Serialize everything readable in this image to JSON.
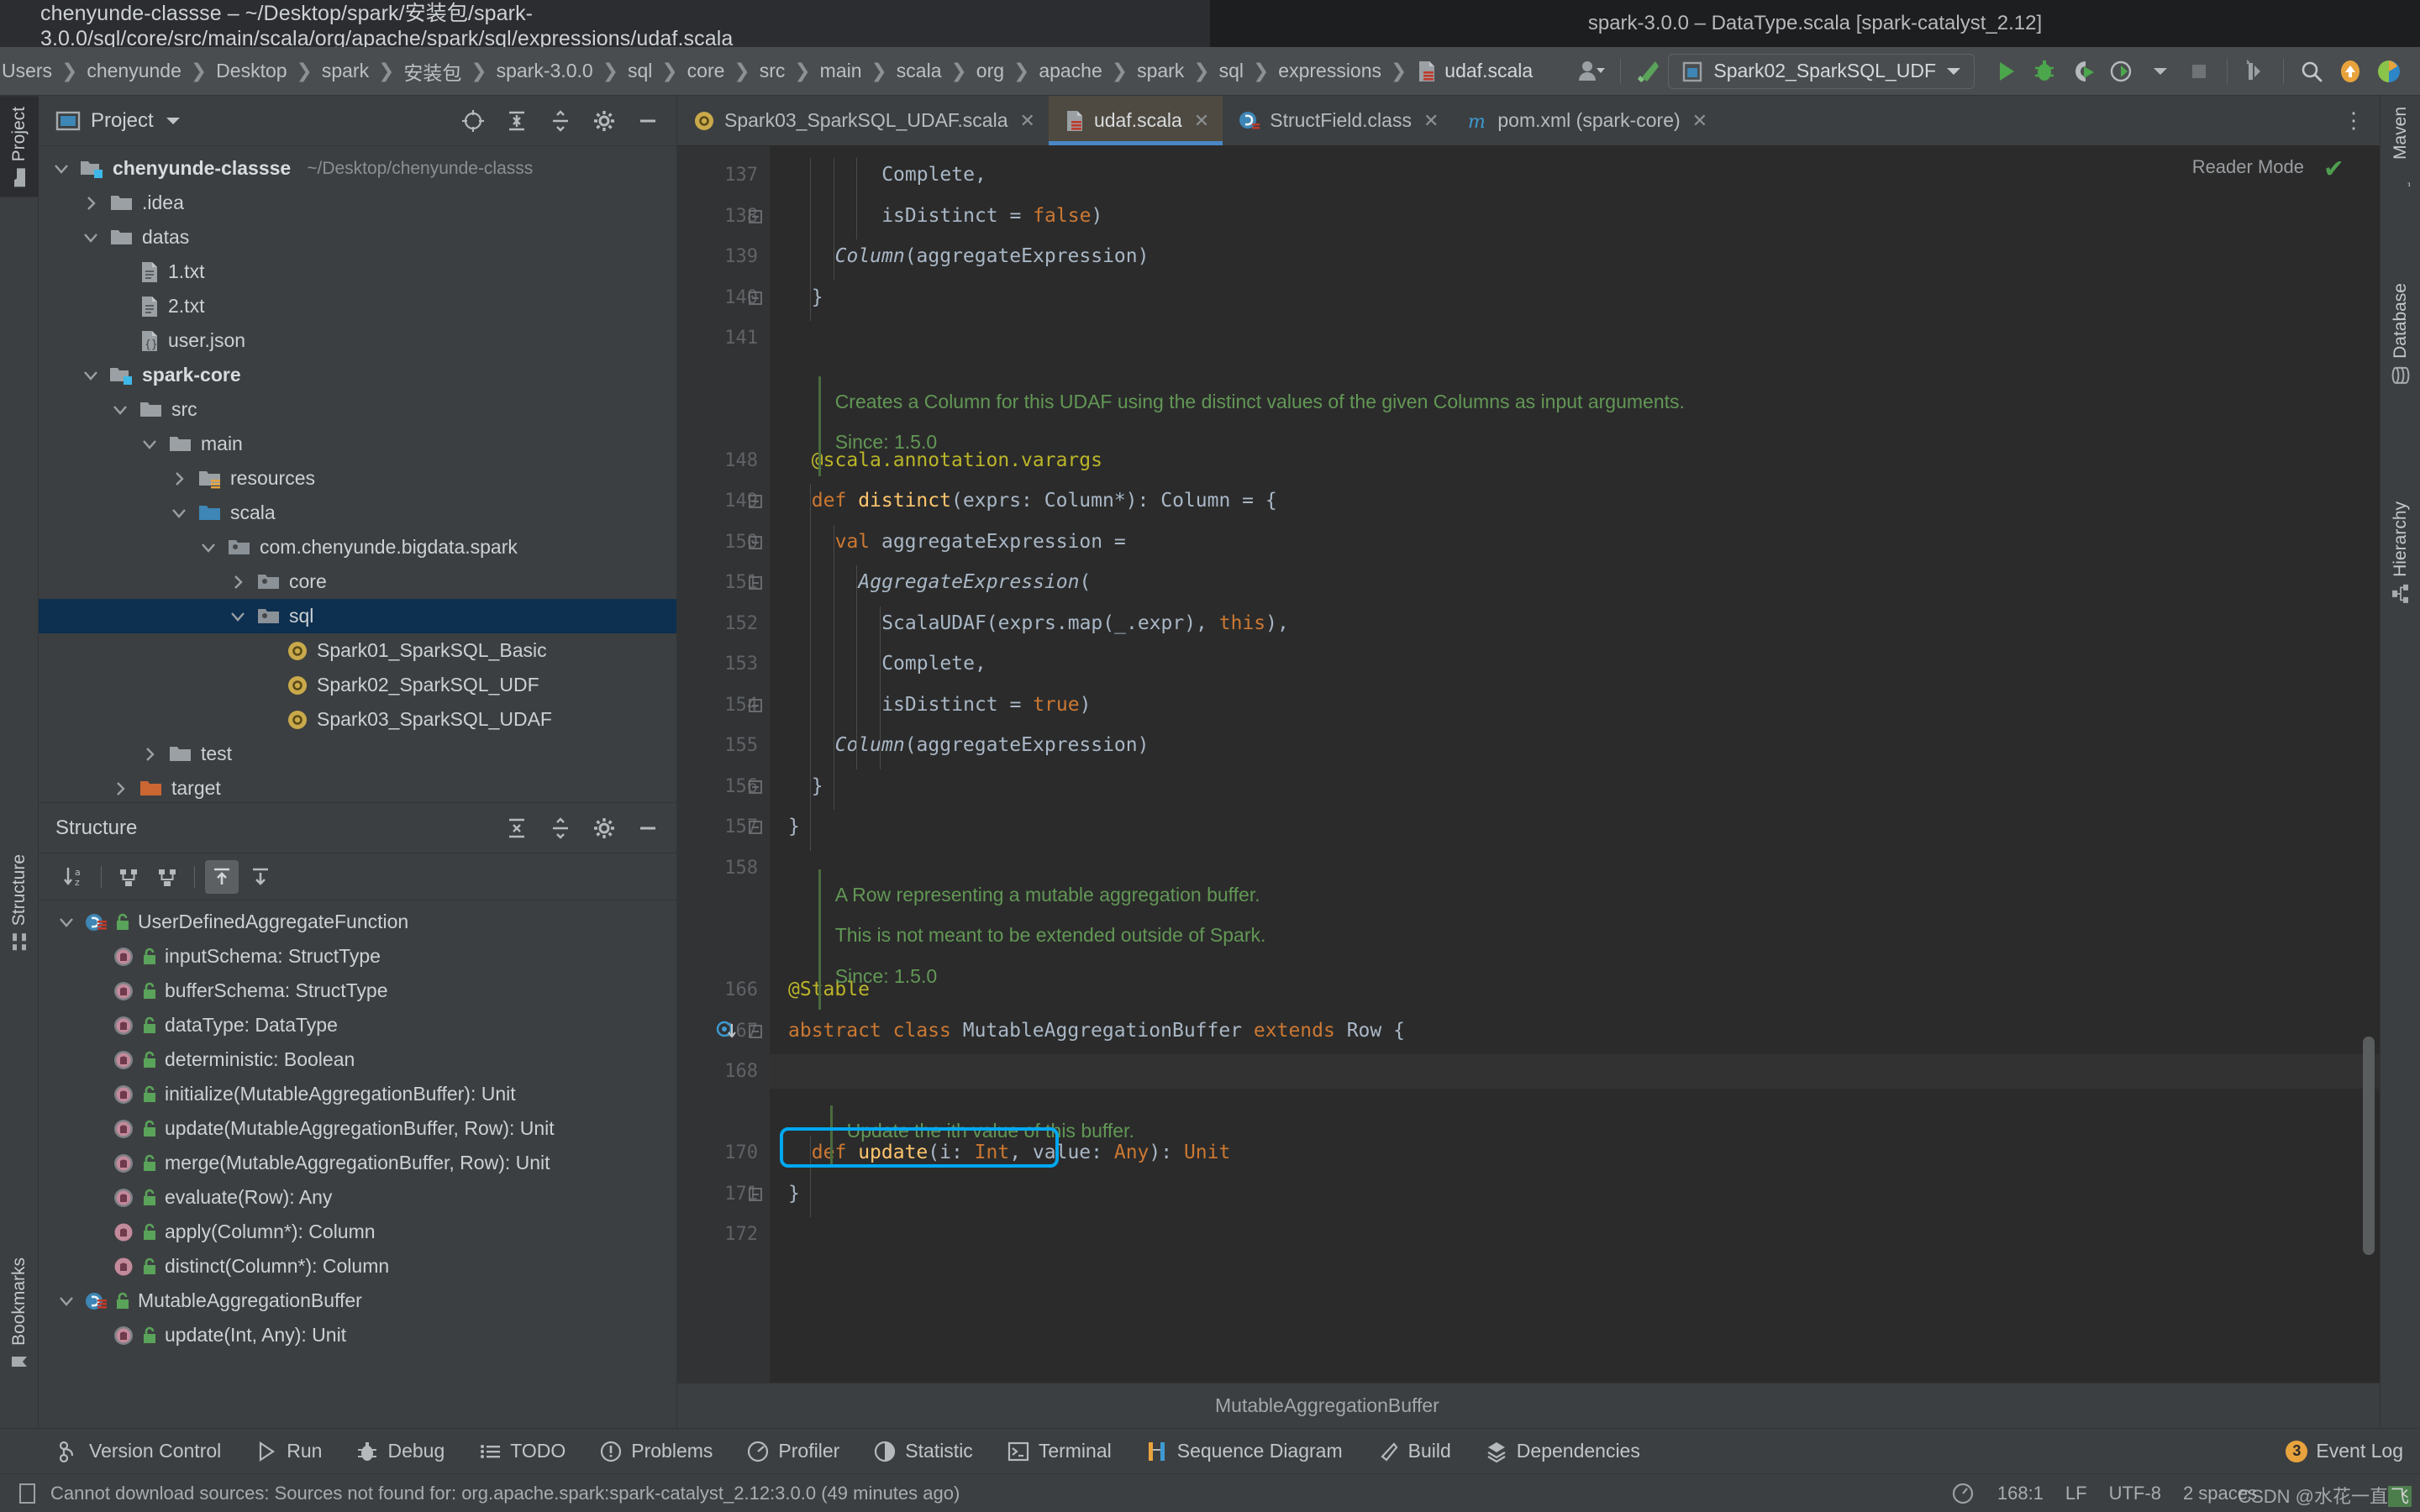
{
  "window": {
    "left_title": "chenyunde-classse – ~/Desktop/spark/安装包/spark-3.0.0/sql/core/src/main/scala/org/apache/spark/sql/expressions/udaf.scala",
    "right_title": "spark-3.0.0 – DataType.scala [spark-catalyst_2.12]"
  },
  "breadcrumbs": [
    "Users",
    "chenyunde",
    "Desktop",
    "spark",
    "安装包",
    "spark-3.0.0",
    "sql",
    "core",
    "src",
    "main",
    "scala",
    "org",
    "apache",
    "spark",
    "sql",
    "expressions",
    "udaf.scala"
  ],
  "toolbar": {
    "run_config": "Spark02_SparkSQL_UDF",
    "icons": [
      "user-avatar-icon",
      "hammer-build-icon",
      "run-icon",
      "debug-icon",
      "run-with-coverage-icon",
      "profile-icon",
      "stop-icon",
      "update-project-icon",
      "search-everywhere-icon",
      "updates-icon",
      "idea-feedback-icon"
    ]
  },
  "left_rail": {
    "tabs": [
      {
        "label": "Project",
        "icon": "folder-icon",
        "active": true
      },
      {
        "label": "Structure",
        "icon": "structure-icon",
        "active": false
      },
      {
        "label": "Bookmarks",
        "icon": "bookmark-icon",
        "active": false
      }
    ]
  },
  "right_rail": {
    "tabs": [
      {
        "label": "Maven",
        "icon": "maven-icon"
      },
      {
        "label": "Database",
        "icon": "database-icon"
      },
      {
        "label": "Hierarchy",
        "icon": "hierarchy-icon"
      }
    ]
  },
  "project_panel": {
    "title": "Project",
    "toolbar_icons": [
      "locate-icon",
      "expand-all-icon",
      "collapse-all-icon",
      "gear-icon",
      "hide-icon"
    ],
    "tree": [
      {
        "indent": 0,
        "arrow": "down",
        "icon": "module-folder-icon",
        "label": "chenyunde-classse",
        "bold": true,
        "path": "~/Desktop/chenyunde-classs",
        "selected": false
      },
      {
        "indent": 1,
        "arrow": "right",
        "icon": "folder-icon",
        "label": ".idea",
        "bold": false,
        "path": "",
        "selected": false
      },
      {
        "indent": 1,
        "arrow": "down",
        "icon": "folder-icon",
        "label": "datas",
        "bold": false,
        "path": "",
        "selected": false
      },
      {
        "indent": 2,
        "arrow": "",
        "icon": "text-file-icon",
        "label": "1.txt",
        "bold": false,
        "path": "",
        "selected": false
      },
      {
        "indent": 2,
        "arrow": "",
        "icon": "text-file-icon",
        "label": "2.txt",
        "bold": false,
        "path": "",
        "selected": false
      },
      {
        "indent": 2,
        "arrow": "",
        "icon": "json-file-icon",
        "label": "user.json",
        "bold": false,
        "path": "",
        "selected": false
      },
      {
        "indent": 1,
        "arrow": "down",
        "icon": "module-folder-icon",
        "label": "spark-core",
        "bold": true,
        "path": "",
        "selected": false
      },
      {
        "indent": 2,
        "arrow": "down",
        "icon": "folder-icon",
        "label": "src",
        "bold": false,
        "path": "",
        "selected": false
      },
      {
        "indent": 3,
        "arrow": "down",
        "icon": "folder-icon",
        "label": "main",
        "bold": false,
        "path": "",
        "selected": false
      },
      {
        "indent": 4,
        "arrow": "right",
        "icon": "resources-folder-icon",
        "label": "resources",
        "bold": false,
        "path": "",
        "selected": false
      },
      {
        "indent": 4,
        "arrow": "down",
        "icon": "source-folder-icon",
        "label": "scala",
        "bold": false,
        "path": "",
        "selected": false
      },
      {
        "indent": 5,
        "arrow": "down",
        "icon": "package-icon",
        "label": "com.chenyunde.bigdata.spark",
        "bold": false,
        "path": "",
        "selected": false
      },
      {
        "indent": 6,
        "arrow": "right",
        "icon": "package-icon",
        "label": "core",
        "bold": false,
        "path": "",
        "selected": false
      },
      {
        "indent": 6,
        "arrow": "down",
        "icon": "package-icon",
        "label": "sql",
        "bold": false,
        "path": "",
        "selected": true
      },
      {
        "indent": 7,
        "arrow": "",
        "icon": "scala-object-icon",
        "label": "Spark01_SparkSQL_Basic",
        "bold": false,
        "path": "",
        "selected": false
      },
      {
        "indent": 7,
        "arrow": "",
        "icon": "scala-object-icon",
        "label": "Spark02_SparkSQL_UDF",
        "bold": false,
        "path": "",
        "selected": false
      },
      {
        "indent": 7,
        "arrow": "",
        "icon": "scala-object-icon",
        "label": "Spark03_SparkSQL_UDAF",
        "bold": false,
        "path": "",
        "selected": false
      },
      {
        "indent": 3,
        "arrow": "right",
        "icon": "folder-icon",
        "label": "test",
        "bold": false,
        "path": "",
        "selected": false
      },
      {
        "indent": 2,
        "arrow": "right",
        "icon": "excluded-folder-icon",
        "label": "target",
        "bold": false,
        "path": "",
        "selected": false
      }
    ]
  },
  "structure_panel": {
    "title": "Structure",
    "toolbar_icons": [
      "sort-alphabetically-icon",
      "expand-all-icon",
      "collapse-all-icon",
      "scroll-from-source-icon",
      "scroll-to-source-icon"
    ],
    "items": [
      {
        "indent": 0,
        "arrow": "down",
        "icon": "scala-trait-icon",
        "label": "UserDefinedAggregateFunction"
      },
      {
        "indent": 1,
        "arrow": "",
        "icon": "abstract-method-icon",
        "label": "inputSchema: StructType"
      },
      {
        "indent": 1,
        "arrow": "",
        "icon": "abstract-method-icon",
        "label": "bufferSchema: StructType"
      },
      {
        "indent": 1,
        "arrow": "",
        "icon": "abstract-method-icon",
        "label": "dataType: DataType"
      },
      {
        "indent": 1,
        "arrow": "",
        "icon": "abstract-method-icon",
        "label": "deterministic: Boolean"
      },
      {
        "indent": 1,
        "arrow": "",
        "icon": "abstract-method-icon",
        "label": "initialize(MutableAggregationBuffer): Unit"
      },
      {
        "indent": 1,
        "arrow": "",
        "icon": "abstract-method-icon",
        "label": "update(MutableAggregationBuffer, Row): Unit"
      },
      {
        "indent": 1,
        "arrow": "",
        "icon": "abstract-method-icon",
        "label": "merge(MutableAggregationBuffer, Row): Unit"
      },
      {
        "indent": 1,
        "arrow": "",
        "icon": "abstract-method-icon",
        "label": "evaluate(Row): Any"
      },
      {
        "indent": 1,
        "arrow": "",
        "icon": "method-icon",
        "label": "apply(Column*): Column"
      },
      {
        "indent": 1,
        "arrow": "",
        "icon": "method-icon",
        "label": "distinct(Column*): Column"
      },
      {
        "indent": 0,
        "arrow": "down",
        "icon": "scala-trait-icon",
        "label": "MutableAggregationBuffer"
      },
      {
        "indent": 1,
        "arrow": "",
        "icon": "abstract-method-icon",
        "label": "update(Int, Any): Unit"
      }
    ]
  },
  "editor": {
    "tabs": [
      {
        "label": "Spark03_SparkSQL_UDAF.scala",
        "icon": "scala-object-icon",
        "active": false
      },
      {
        "label": "udaf.scala",
        "icon": "scala-file-icon",
        "active": true
      },
      {
        "label": "StructField.class",
        "icon": "class-file-icon",
        "active": false
      },
      {
        "label": "pom.xml (spark-core)",
        "icon": "maven-xml-icon",
        "active": false
      }
    ],
    "reader_mode": "Reader Mode",
    "breadcrumb_status": "MutableAggregationBuffer",
    "lines": [
      {
        "num": "137",
        "y": 0,
        "indent": 8,
        "tokens": [
          {
            "t": "Complete",
            "c": "txt"
          },
          {
            "t": ",",
            "c": "txt"
          }
        ]
      },
      {
        "num": "138",
        "y": 1,
        "indent": 8,
        "tokens": [
          {
            "t": "isDistinct = ",
            "c": "txt"
          },
          {
            "t": "false",
            "c": "key"
          },
          {
            "t": ")",
            "c": "txt"
          }
        ]
      },
      {
        "num": "139",
        "y": 2,
        "indent": 4,
        "tokens": [
          {
            "t": "Column",
            "c": "italic"
          },
          {
            "t": "(aggregateExpression)",
            "c": "txt"
          }
        ]
      },
      {
        "num": "140",
        "y": 3,
        "indent": 2,
        "tokens": [
          {
            "t": "}",
            "c": "txt"
          }
        ]
      },
      {
        "num": "141",
        "y": 4,
        "indent": 0,
        "tokens": []
      },
      {
        "num": "148",
        "y": 7,
        "indent": 2,
        "tokens": [
          {
            "t": "@scala.annotation.varargs",
            "c": "ann"
          }
        ]
      },
      {
        "num": "149",
        "y": 8,
        "indent": 2,
        "tokens": [
          {
            "t": "def ",
            "c": "key"
          },
          {
            "t": "distinct",
            "c": "fn"
          },
          {
            "t": "(exprs: Column*): Column = {",
            "c": "txt"
          }
        ]
      },
      {
        "num": "150",
        "y": 9,
        "indent": 4,
        "tokens": [
          {
            "t": "val ",
            "c": "key"
          },
          {
            "t": "aggregateExpression =",
            "c": "txt"
          }
        ]
      },
      {
        "num": "151",
        "y": 10,
        "indent": 6,
        "tokens": [
          {
            "t": "AggregateExpression",
            "c": "italic"
          },
          {
            "t": "(",
            "c": "txt"
          }
        ]
      },
      {
        "num": "152",
        "y": 11,
        "indent": 8,
        "tokens": [
          {
            "t": "ScalaUDAF(exprs.map(_.expr), ",
            "c": "txt"
          },
          {
            "t": "this",
            "c": "key"
          },
          {
            "t": "),",
            "c": "txt"
          }
        ]
      },
      {
        "num": "153",
        "y": 12,
        "indent": 8,
        "tokens": [
          {
            "t": "Complete,",
            "c": "txt"
          }
        ]
      },
      {
        "num": "154",
        "y": 13,
        "indent": 8,
        "tokens": [
          {
            "t": "isDistinct = ",
            "c": "txt"
          },
          {
            "t": "true",
            "c": "key"
          },
          {
            "t": ")",
            "c": "txt"
          }
        ]
      },
      {
        "num": "155",
        "y": 14,
        "indent": 4,
        "tokens": [
          {
            "t": "Column",
            "c": "italic"
          },
          {
            "t": "(aggregateExpression)",
            "c": "txt"
          }
        ]
      },
      {
        "num": "156",
        "y": 15,
        "indent": 2,
        "tokens": [
          {
            "t": "}",
            "c": "txt"
          }
        ]
      },
      {
        "num": "157",
        "y": 16,
        "indent": 0,
        "tokens": [
          {
            "t": "}",
            "c": "txt"
          }
        ]
      },
      {
        "num": "158",
        "y": 17,
        "indent": 0,
        "tokens": []
      },
      {
        "num": "166",
        "y": 20,
        "indent": 0,
        "tokens": [
          {
            "t": "@Stable",
            "c": "ann"
          }
        ]
      },
      {
        "num": "167",
        "y": 21,
        "indent": 0,
        "tokens": [
          {
            "t": "abstract class ",
            "c": "key"
          },
          {
            "t": "MutableAggregationBuffer ",
            "c": "txt"
          },
          {
            "t": "extends ",
            "c": "key"
          },
          {
            "t": "Row {",
            "c": "txt"
          }
        ]
      },
      {
        "num": "168",
        "y": 22,
        "indent": 0,
        "tokens": []
      },
      {
        "num": "170",
        "y": 24,
        "indent": 2,
        "tokens": [
          {
            "t": "def ",
            "c": "key"
          },
          {
            "t": "update",
            "c": "fn"
          },
          {
            "t": "(i: ",
            "c": "txt"
          },
          {
            "t": "Int",
            "c": "key"
          },
          {
            "t": ", value: ",
            "c": "txt"
          },
          {
            "t": "Any",
            "c": "key"
          },
          {
            "t": "): ",
            "c": "txt"
          },
          {
            "t": "Unit",
            "c": "key"
          }
        ]
      },
      {
        "num": "171",
        "y": 25,
        "indent": 0,
        "tokens": [
          {
            "t": "}",
            "c": "txt"
          }
        ]
      },
      {
        "num": "172",
        "y": 26,
        "indent": 0,
        "tokens": []
      }
    ],
    "doc_blocks": [
      {
        "y": 5.4,
        "indent": 3,
        "lines": [
          "Creates a Column for this UDAF using the distinct values of the given Columns as input arguments.",
          "Since: 1.5.0"
        ]
      },
      {
        "y": 17.5,
        "indent": 3,
        "lines": [
          "A Row representing a mutable aggregation buffer.",
          "This is not meant to be extended outside of Spark.",
          "Since: 1.5.0"
        ]
      },
      {
        "y": 23.3,
        "indent": 4,
        "lines": [
          "Update the ith value of this buffer."
        ]
      }
    ]
  },
  "bottom_toolbar": {
    "items": [
      {
        "label": "Version Control",
        "icon": "version-control-icon"
      },
      {
        "label": "Run",
        "icon": "run-icon"
      },
      {
        "label": "Debug",
        "icon": "debug-icon"
      },
      {
        "label": "TODO",
        "icon": "todo-icon"
      },
      {
        "label": "Problems",
        "icon": "problems-icon"
      },
      {
        "label": "Profiler",
        "icon": "profiler-icon"
      },
      {
        "label": "Statistic",
        "icon": "statistic-icon"
      },
      {
        "label": "Terminal",
        "icon": "terminal-icon"
      },
      {
        "label": "Sequence Diagram",
        "icon": "sequence-diagram-icon"
      },
      {
        "label": "Build",
        "icon": "build-icon"
      },
      {
        "label": "Dependencies",
        "icon": "dependencies-icon"
      }
    ],
    "event_log": {
      "label": "Event Log",
      "count": "3"
    }
  },
  "status_bar": {
    "message": "Cannot download sources: Sources not found for: org.apache.spark:spark-catalyst_2.12:3.0.0 (49 minutes ago)",
    "caret": "168:1",
    "line_separator": "LF",
    "encoding": "UTF-8",
    "indent": "2 spaces",
    "watermark_left": "CSDN @水花一直",
    "watermark_right": "飞"
  }
}
